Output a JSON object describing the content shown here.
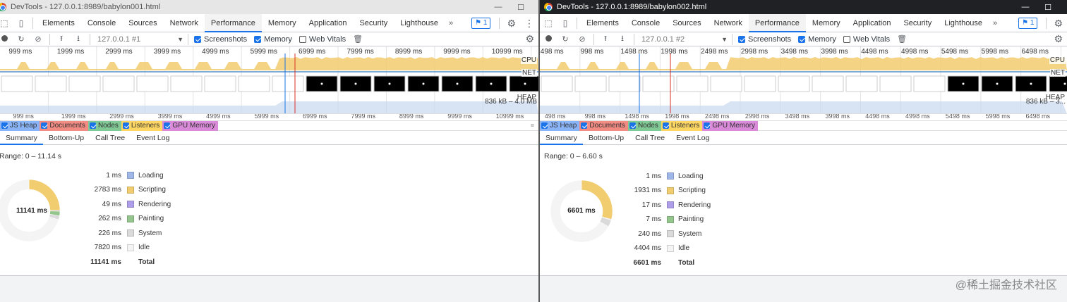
{
  "colors": {
    "loading": "#9fb6e8",
    "scripting": "#f2cd6f",
    "rendering": "#ae9de8",
    "painting": "#93c58c",
    "system": "#dadada",
    "idle": "#f4f4f4",
    "accent": "#1a73e8",
    "cpu_fill": "#f2cd6f"
  },
  "windows": [
    {
      "title": "DevTools - 127.0.0.1:8989/babylon001.html",
      "window_controls": [
        "—",
        "☐"
      ],
      "tabs": [
        "Elements",
        "Console",
        "Sources",
        "Network",
        "Performance",
        "Memory",
        "Application",
        "Security",
        "Lighthouse"
      ],
      "active_tab": "Performance",
      "more_tabs": "»",
      "issues_badge": "1",
      "profile_select": "127.0.0.1 #1",
      "checkboxes": [
        {
          "label": "Screenshots",
          "checked": true
        },
        {
          "label": "Memory",
          "checked": true
        },
        {
          "label": "Web Vitals",
          "checked": false
        }
      ],
      "overview_ticks": [
        "999 ms",
        "1999 ms",
        "2999 ms",
        "3999 ms",
        "4999 ms",
        "5999 ms",
        "6999 ms",
        "7999 ms",
        "8999 ms",
        "9999 ms",
        "10999 ms"
      ],
      "overview_labels": {
        "cpu": "CPU",
        "net": "NET",
        "heap": "HEAP",
        "heap_range": "836 kB – 4.0 MB"
      },
      "ruler_ticks": [
        "999 ms",
        "1999 ms",
        "2999 ms",
        "3999 ms",
        "4999 ms",
        "5999 ms",
        "6999 ms",
        "7999 ms",
        "8999 ms",
        "9999 ms",
        "10999 ms"
      ],
      "counters": [
        {
          "label": "JS Heap",
          "color": "#8ab4f8"
        },
        {
          "label": "Documents",
          "color": "#f28b82"
        },
        {
          "label": "Nodes",
          "color": "#81c995"
        },
        {
          "label": "Listeners",
          "color": "#fdd663"
        },
        {
          "label": "GPU Memory",
          "color": "#d98ad9"
        }
      ],
      "bottom_tabs": [
        "Summary",
        "Bottom-Up",
        "Call Tree",
        "Event Log"
      ],
      "active_bottom_tab": "Summary",
      "range": "Range: 0 – 11.14 s",
      "donut_total": "11141 ms",
      "summary": [
        {
          "value": "1 ms",
          "label": "Loading",
          "ms": 1,
          "key": "loading"
        },
        {
          "value": "2783 ms",
          "label": "Scripting",
          "ms": 2783,
          "key": "scripting"
        },
        {
          "value": "49 ms",
          "label": "Rendering",
          "ms": 49,
          "key": "rendering"
        },
        {
          "value": "262 ms",
          "label": "Painting",
          "ms": 262,
          "key": "painting"
        },
        {
          "value": "226 ms",
          "label": "System",
          "ms": 226,
          "key": "system"
        },
        {
          "value": "7820 ms",
          "label": "Idle",
          "ms": 7820,
          "key": "idle"
        }
      ],
      "total": {
        "value": "11141 ms",
        "label": "Total"
      }
    },
    {
      "title": "DevTools - 127.0.0.1:8989/babylon002.html",
      "window_controls": [
        "—",
        "☐"
      ],
      "tabs": [
        "Elements",
        "Console",
        "Sources",
        "Network",
        "Performance",
        "Memory",
        "Application",
        "Security",
        "Lighthouse"
      ],
      "active_tab": "Performance",
      "more_tabs": "»",
      "issues_badge": "1",
      "profile_select": "127.0.0.1 #2",
      "checkboxes": [
        {
          "label": "Screenshots",
          "checked": true
        },
        {
          "label": "Memory",
          "checked": true
        },
        {
          "label": "Web Vitals",
          "checked": false
        }
      ],
      "overview_ticks": [
        "498 ms",
        "998 ms",
        "1498 ms",
        "1998 ms",
        "2498 ms",
        "2998 ms",
        "3498 ms",
        "3998 ms",
        "4498 ms",
        "4998 ms",
        "5498 ms",
        "5998 ms",
        "6498 ms"
      ],
      "overview_labels": {
        "cpu": "CPU",
        "net": "NET",
        "heap": "HEAP",
        "heap_range": "836 kB – 3..."
      },
      "ruler_ticks": [
        "498 ms",
        "998 ms",
        "1498 ms",
        "1998 ms",
        "2498 ms",
        "2998 ms",
        "3498 ms",
        "3998 ms",
        "4498 ms",
        "4998 ms",
        "5498 ms",
        "5998 ms",
        "6498 ms"
      ],
      "counters": [
        {
          "label": "JS Heap",
          "color": "#8ab4f8"
        },
        {
          "label": "Documents",
          "color": "#f28b82"
        },
        {
          "label": "Nodes",
          "color": "#81c995"
        },
        {
          "label": "Listeners",
          "color": "#fdd663"
        },
        {
          "label": "GPU Memory",
          "color": "#d98ad9"
        }
      ],
      "bottom_tabs": [
        "Summary",
        "Bottom-Up",
        "Call Tree",
        "Event Log"
      ],
      "active_bottom_tab": "Summary",
      "range": "Range: 0 – 6.60 s",
      "donut_total": "6601 ms",
      "summary": [
        {
          "value": "1 ms",
          "label": "Loading",
          "ms": 1,
          "key": "loading"
        },
        {
          "value": "1931 ms",
          "label": "Scripting",
          "ms": 1931,
          "key": "scripting"
        },
        {
          "value": "17 ms",
          "label": "Rendering",
          "ms": 17,
          "key": "rendering"
        },
        {
          "value": "7 ms",
          "label": "Painting",
          "ms": 7,
          "key": "painting"
        },
        {
          "value": "240 ms",
          "label": "System",
          "ms": 240,
          "key": "system"
        },
        {
          "value": "4404 ms",
          "label": "Idle",
          "ms": 4404,
          "key": "idle"
        }
      ],
      "total": {
        "value": "6601 ms",
        "label": "Total"
      }
    }
  ],
  "watermark": "@稀土掘金技术社区"
}
